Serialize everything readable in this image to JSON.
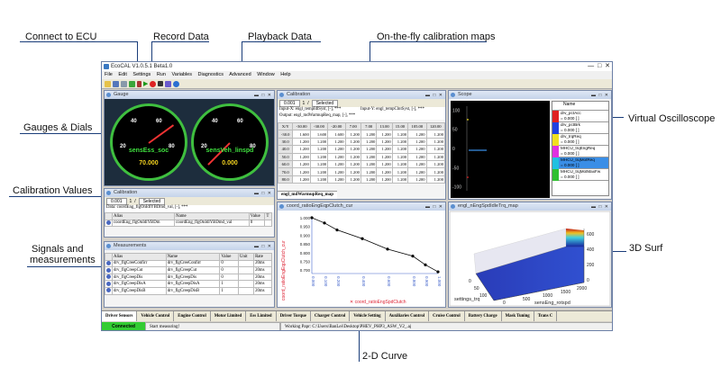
{
  "annotations": {
    "connect": "Connect to ECU",
    "record": "Record Data",
    "playback": "Playback Data",
    "calmaps": "On-the-fly calibration maps",
    "gauges": "Gauges & Dials",
    "calvalues": "Calibration Values",
    "signals_l1": "Signals and",
    "signals_l2": "measurements",
    "vosc": "Virtual Oscilloscope",
    "surf": "3D Surf",
    "curve": "2-D Curve"
  },
  "app": {
    "title": "EcoCAL V1.0.5.1 Beta1.0",
    "menu": [
      "File",
      "Edit",
      "Settings",
      "Run",
      "Variables",
      "Diagnostics",
      "Advanced",
      "Window",
      "Help"
    ]
  },
  "gauge_panel": {
    "title": "Gauge",
    "gauges": [
      {
        "name": "sensEss_soc",
        "value": "70.000",
        "ticks": [
          "20",
          "40",
          "60",
          "80"
        ],
        "level": 0.7
      },
      {
        "name": "sensVeh_linspd",
        "value": "0.000",
        "ticks": [
          "20",
          "40",
          "60",
          "80"
        ],
        "level": 0.0
      }
    ]
  },
  "calibration_panel": {
    "title": "Calibration",
    "step": "0.001",
    "num": "1",
    "slash": "/",
    "selected": "Selected",
    "input_x": "Input-X: engl_tempIdlSyst, [-], ***",
    "input_y": "Input-Y: engl_tempClntSyst, [-], ***",
    "output": "Output: engl_mdWarmupReq_map, [-], ***",
    "xy_label": "X/Y",
    "header": [
      "-30.00",
      "-30.00",
      "-20.00",
      "7.00",
      "7.00",
      "13.00",
      "15.00",
      "105.00",
      "120.00"
    ],
    "rows": [
      [
        "-30.0",
        "1.600",
        "1.600",
        "1.600",
        "1.200",
        "1.200",
        "1.200",
        "1.200",
        "1.200",
        "1.200"
      ],
      [
        "30.0",
        "1.200",
        "1.200",
        "1.200",
        "1.200",
        "1.200",
        "1.200",
        "1.200",
        "1.200",
        "1.200"
      ],
      [
        "40.0",
        "1.200",
        "1.200",
        "1.200",
        "1.200",
        "1.200",
        "1.200",
        "1.200",
        "1.200",
        "1.200"
      ],
      [
        "50.0",
        "1.200",
        "1.200",
        "1.200",
        "1.200",
        "1.200",
        "1.200",
        "1.200",
        "1.200",
        "1.200"
      ],
      [
        "60.0",
        "1.200",
        "1.200",
        "1.200",
        "1.200",
        "1.200",
        "1.200",
        "1.200",
        "1.200",
        "1.200"
      ],
      [
        "70.0",
        "1.200",
        "1.200",
        "1.200",
        "1.200",
        "1.200",
        "1.200",
        "1.200",
        "1.200",
        "1.200"
      ],
      [
        "80.0",
        "1.200",
        "1.200",
        "1.200",
        "1.200",
        "1.200",
        "1.200",
        "1.200",
        "1.200",
        "1.200"
      ]
    ],
    "tab": "engl_mdWarmupReq_map"
  },
  "calvalue_panel": {
    "title": "Calibration",
    "step": "0.001",
    "num": "1",
    "slash": "/",
    "selected": "Selected",
    "data": "Data: coordEng_flgOnIdlYBDmd_val, [-], ***",
    "headers": [
      "Alias",
      "Name",
      "Value",
      "T"
    ],
    "row": [
      "coordEng_flgOnIdlYBDm",
      "coordEng_flgOnIdlYBDmd_val",
      "0",
      ""
    ]
  },
  "meas_panel": {
    "title": "Measurements",
    "headers": [
      "Alias",
      "Name",
      "Value",
      "Unit",
      "Rate"
    ],
    "rows": [
      [
        "drv_flgCreeConfirr",
        "drv_flgCreeConfirr",
        "0",
        "",
        "20ms"
      ],
      [
        "drv_flgCreepCut",
        "drv_flgCreepCut",
        "0",
        "",
        "20ms"
      ],
      [
        "drv_flgCreepDis",
        "drv_flgCreepDis",
        "0",
        "",
        "20ms"
      ],
      [
        "drv_flgCreepDisA",
        "drv_flgCreepDisA",
        "1",
        "",
        "20ms"
      ],
      [
        "drv_flgCreepDisB",
        "drv_flgCreepDisB",
        "1",
        "",
        "20ms"
      ]
    ]
  },
  "curve_panel": {
    "title": "coord_ratioEngEqpClutch_cur",
    "ylabel": "coord_ratioEngEqpClutch_cur",
    "xlabel": "coord_ratioEngSpdClutch"
  },
  "chart_data": [
    {
      "type": "line",
      "title": "",
      "xlabel": "coord_ratioEngSpdClutch",
      "ylabel": "coord_ratioEngEqpClutch_cur",
      "x": [
        0.0,
        0.1,
        0.2,
        0.4,
        0.6,
        0.8,
        0.9,
        1.0
      ],
      "y": [
        1.0,
        0.97,
        0.93,
        0.88,
        0.82,
        0.78,
        0.73,
        0.69
      ],
      "xticks": [
        "0.000",
        "0.100",
        "0.200",
        "0.400",
        "0.600",
        "0.800",
        "0.900",
        "1.000"
      ],
      "yticks": [
        "1.000",
        "0.950",
        "0.900",
        "0.850",
        "0.800",
        "0.750",
        "0.700"
      ],
      "ylim": [
        0.68,
        1.0
      ],
      "grid": false
    },
    {
      "type": "line",
      "title": "Scope",
      "yticks": [
        "100",
        "50",
        "0",
        "-50",
        "-100"
      ],
      "ylim": [
        -110,
        110
      ]
    }
  ],
  "scope_panel": {
    "title": "Scope",
    "legend_header": "Name",
    "legend": [
      {
        "color": "#e02020",
        "text": "drv_pctAcc",
        "val": "= 0.000 [ ]"
      },
      {
        "color": "#2040e0",
        "text": "drv_pctBrk",
        "val": "= 0.000 [ ]"
      },
      {
        "color": "#f0e020",
        "text": "drv_trqReq",
        "val": "= 0.000 [ ]"
      },
      {
        "color": "#e030e0",
        "text": "MHCU_trqEngReq",
        "val": "= 0.000 [ ]"
      },
      {
        "color": "#20c0e0",
        "text": "MHCU_trqMotReq",
        "val": "= 0.000 [ ]"
      },
      {
        "color": "#30c030",
        "text": "MHCU_trqMotMaxFw",
        "val": "= 0.000 [ ]"
      }
    ]
  },
  "surf_panel": {
    "title": "engl_nEngSpdIdleTrq_map",
    "xaxis": "sensEng_rotspd",
    "yaxis": "settings_trq",
    "zticks": [
      "600",
      "400",
      "200",
      "0"
    ],
    "xticks": [
      "0",
      "500",
      "1000",
      "1500",
      "2000"
    ],
    "yticks": [
      "0",
      "50",
      "100"
    ]
  },
  "bottom_tabs": [
    "Driver Sensors",
    "Vehicle Control",
    "Engine Control",
    "Motor Limited",
    "Ess Limited",
    "Driver Torque",
    "Charger Control",
    "Vehicle Setting",
    "Auxiliaries Control",
    "Cruise Control",
    "Battery Charge",
    "Mask Tuning",
    "Trans C"
  ],
  "status": {
    "connected": "Connected",
    "msg": "Start measuring!",
    "path": "Working Papr:  C:\\Users\\BanLei\\Desktop\\PHEV_PHP3_ASW_V2_.aj"
  }
}
